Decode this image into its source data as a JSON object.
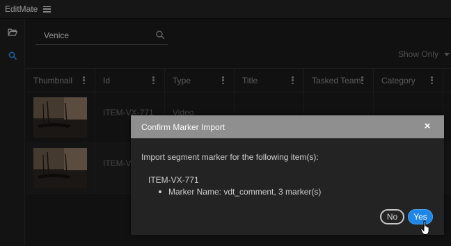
{
  "app": {
    "title": "EditMate"
  },
  "search": {
    "value": "Venice",
    "placeholder": ""
  },
  "filter": {
    "label": "Show Only"
  },
  "table": {
    "columns": [
      "Thumbnail",
      "Id",
      "Type",
      "Title",
      "Tasked Team",
      "Category"
    ],
    "rows": [
      {
        "id": "ITEM-VX-771",
        "type": "Video",
        "title": "",
        "tasked_team": "",
        "category": ""
      },
      {
        "id": "ITEM-V",
        "type": "",
        "title": "",
        "tasked_team": "",
        "category": ""
      }
    ]
  },
  "dialog": {
    "title": "Confirm Marker Import",
    "message": "Import segment marker for the following item(s):",
    "item_id": "ITEM-VX-771",
    "bullet": "Marker Name: vdt_comment, 3 marker(s)",
    "no_label": "No",
    "yes_label": "Yes",
    "close_glyph": "×"
  },
  "colors": {
    "accent": "#1f86e6",
    "dialog_header": "#8f8f8f",
    "background": "#1b1b1b"
  },
  "icons": {
    "menu": "hamburger-menu-icon",
    "folder": "folder-open-icon",
    "search_rail": "search-icon",
    "search_field": "search-icon",
    "column_menu": "kebab-icon",
    "close": "close-icon",
    "cursor": "hand-pointer-icon"
  }
}
